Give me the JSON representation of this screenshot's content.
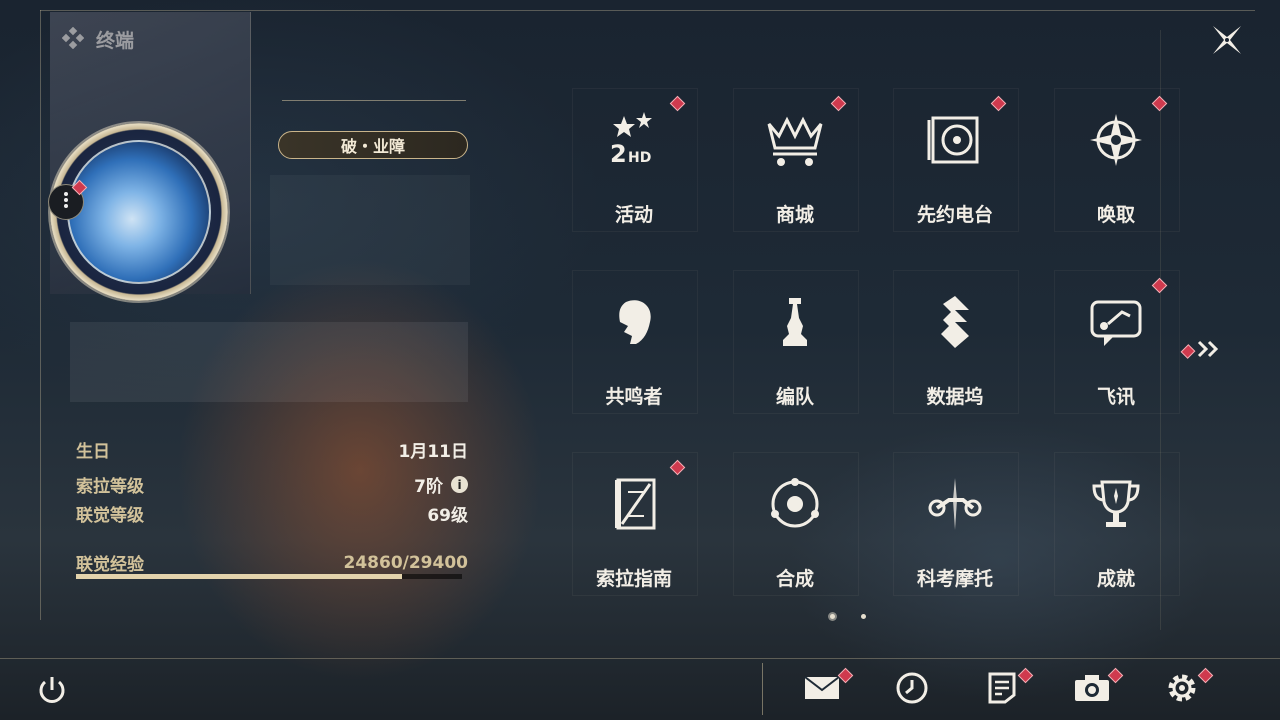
{
  "header": {
    "title": "终端"
  },
  "profile": {
    "title_badge": "破・业障",
    "rows": [
      {
        "label": "生日",
        "value": "1月11日"
      },
      {
        "label": "索拉等级",
        "value": "7阶",
        "info_icon": "info-icon"
      },
      {
        "label": "联觉等级",
        "value": "69级"
      }
    ],
    "exp": {
      "label": "联觉经验",
      "value": "24860/29400",
      "progress": 0.8456
    }
  },
  "grid": {
    "tiles": [
      {
        "label": "活动",
        "icon": "events-icon",
        "badge": true
      },
      {
        "label": "商城",
        "icon": "shop-crown-cart-icon",
        "badge": true
      },
      {
        "label": "先约电台",
        "icon": "radio-vinyl-icon",
        "badge": true
      },
      {
        "label": "唤取",
        "icon": "convene-compass-icon",
        "badge": true
      },
      {
        "label": "共鸣者",
        "icon": "resonator-head-icon",
        "badge": false
      },
      {
        "label": "编队",
        "icon": "chess-team-icon",
        "badge": false
      },
      {
        "label": "数据坞",
        "icon": "data-bank-icon",
        "badge": false
      },
      {
        "label": "飞讯",
        "icon": "message-chat-icon",
        "badge": true
      },
      {
        "label": "索拉指南",
        "icon": "guide-book-icon",
        "badge": true
      },
      {
        "label": "合成",
        "icon": "synthesis-icon",
        "badge": false
      },
      {
        "label": "科考摩托",
        "icon": "motorbike-icon",
        "badge": false
      },
      {
        "label": "成就",
        "icon": "trophy-icon",
        "badge": false
      }
    ],
    "page_indicator": {
      "pages": 2,
      "current": 1
    }
  },
  "bottom_bar": {
    "buttons": [
      {
        "icon": "mail-icon",
        "badge": true
      },
      {
        "icon": "clock-icon",
        "badge": false
      },
      {
        "icon": "notice-icon",
        "badge": true
      },
      {
        "icon": "camera-icon",
        "badge": true
      },
      {
        "icon": "settings-gear-icon",
        "badge": true
      }
    ]
  },
  "colors": {
    "accent": "#d2c29a",
    "badge": "#cf3a4e",
    "text": "#f2eee6"
  }
}
